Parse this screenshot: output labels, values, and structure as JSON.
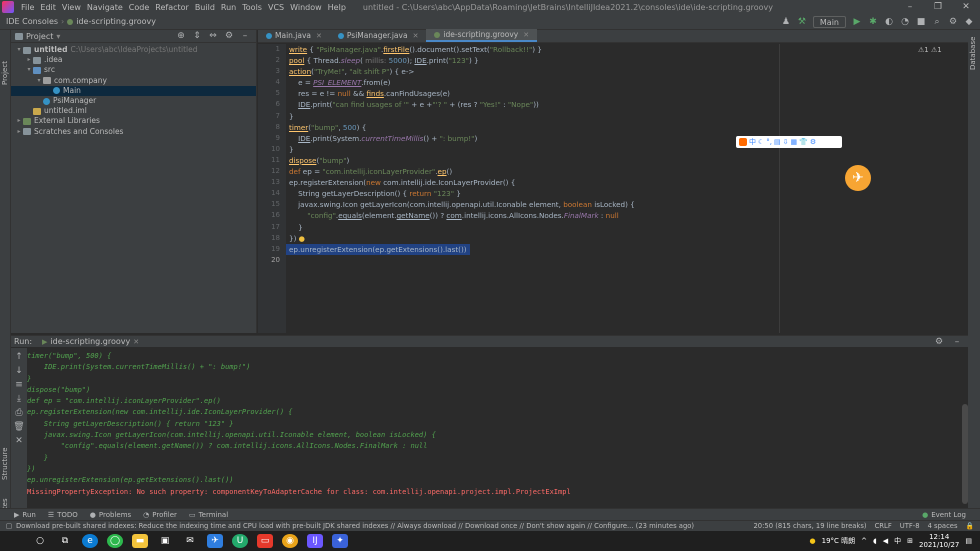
{
  "menubar": {
    "items": [
      "File",
      "Edit",
      "View",
      "Navigate",
      "Code",
      "Refactor",
      "Build",
      "Run",
      "Tools",
      "VCS",
      "Window",
      "Help"
    ],
    "title": "untitled - C:\\Users\\abc\\AppData\\Roaming\\JetBrains\\IntelliJIdea2021.2\\consoles\\ide\\ide-scripting.groovy",
    "win_min": "–",
    "win_max": "❐",
    "win_close": "✕"
  },
  "navbar": {
    "crumbs": [
      "IDE Consoles",
      "ide-scripting.groovy"
    ],
    "run_config": "Main"
  },
  "project": {
    "header": "Project",
    "tree": [
      {
        "label": "untitled",
        "extra": "C:\\Users\\abc\\IdeaProjects\\untitled",
        "indent": 0,
        "arrow": "▾",
        "icon": "folder",
        "bold": true
      },
      {
        "label": ".idea",
        "extra": "",
        "indent": 1,
        "arrow": "▸",
        "icon": "folder"
      },
      {
        "label": "src",
        "extra": "",
        "indent": 1,
        "arrow": "▾",
        "icon": "src"
      },
      {
        "label": "com.company",
        "extra": "",
        "indent": 2,
        "arrow": "▾",
        "icon": "pkg"
      },
      {
        "label": "Main",
        "extra": "",
        "indent": 3,
        "arrow": "",
        "icon": "cls",
        "selected": true
      },
      {
        "label": "PsiManager",
        "extra": "",
        "indent": 2,
        "arrow": "",
        "icon": "cls"
      },
      {
        "label": "untitled.iml",
        "extra": "",
        "indent": 1,
        "arrow": "",
        "icon": "iml"
      },
      {
        "label": "External Libraries",
        "extra": "",
        "indent": 0,
        "arrow": "▸",
        "icon": "lib"
      },
      {
        "label": "Scratches and Consoles",
        "extra": "",
        "indent": 0,
        "arrow": "▸",
        "icon": "folder"
      }
    ]
  },
  "editor": {
    "tabs": [
      {
        "label": "Main.java",
        "color": "#3592c4",
        "active": false
      },
      {
        "label": "PsiManager.java",
        "color": "#3592c4",
        "active": false
      },
      {
        "label": "ide-scripting.groovy",
        "color": "#6a8759",
        "active": true
      }
    ],
    "warnings": "⚠1  ⚠1",
    "line_numbers": [
      "1",
      "2",
      "3",
      "4",
      "5",
      "6",
      "7",
      "8",
      "9",
      "10",
      "11",
      "12",
      "13",
      "14",
      "15",
      "16",
      "17",
      "18",
      "19",
      "20"
    ]
  },
  "ime": {
    "items": [
      "中",
      "☾",
      "°,",
      "▤",
      "⇩",
      "▦",
      "👕",
      "⚙"
    ]
  },
  "run": {
    "label": "Run:",
    "tab": "ide-scripting.groovy",
    "console_lines": [
      "timer(\"bump\", 500) {",
      "    IDE.print(System.currentTimeMillis() + \": bump!\")",
      "}",
      "dispose(\"bump\")",
      "def ep = \"com.intellij.iconLayerProvider\".ep()",
      "ep.registerExtension(new com.intellij.ide.IconLayerProvider() {",
      "    String getLayerDescription() { return \"123\" }",
      "    javax.swing.Icon getLayerIcon(com.intellij.openapi.util.Iconable element, boolean isLocked) {",
      "        \"config\".equals(element.getName()) ? com.intellij.icons.AllIcons.Nodes.FinalMark : null",
      "    }",
      "})",
      "ep.unregisterExtension(ep.getExtensions().last())"
    ],
    "error": "MissingPropertyException: No such property: componentKeyToAdapterCache for class: com.intellij.openapi.project.impl.ProjectExImpl"
  },
  "bottom_tabs": [
    "Run",
    "TODO",
    "Problems",
    "Profiler",
    "Terminal"
  ],
  "event_log": "Event Log",
  "status": {
    "message": "Download pre-built shared indexes: Reduce the indexing time and CPU load with pre-built JDK shared indexes // Always download // Download once // Don't show again // Configure... (23 minutes ago)",
    "position": "20:50 (815 chars, 19 line breaks)",
    "line_sep": "CRLF",
    "encoding": "UTF-8",
    "indent": "4 spaces"
  },
  "taskbar": {
    "weather": "19°C 晴朗",
    "ime": "中",
    "time": "12:14",
    "date": "2021/10/27"
  },
  "stripe_labels": {
    "project": "Project",
    "structure": "Structure",
    "favorites": "Favorites",
    "database": "Database"
  },
  "colors": {
    "selection": "#214283",
    "accent": "#4a88c7",
    "error": "#ff6b68",
    "console_green": "#52a34f"
  }
}
